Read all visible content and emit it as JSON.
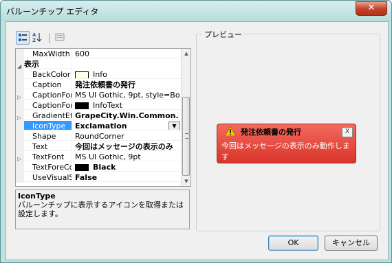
{
  "window": {
    "title": "バルーンチップ エディタ",
    "close_glyph": "✕"
  },
  "toolbar": {
    "categorized_icon": "categorized-view-icon",
    "alphabetical_icon": "sort-az-icon",
    "property_pages_icon": "property-pages-icon"
  },
  "grid": {
    "rows": [
      {
        "name": "MaxWidth",
        "value": "600",
        "type": "prop"
      },
      {
        "name": "表示",
        "value": "",
        "type": "category",
        "expander": "◢"
      },
      {
        "name": "BackColor",
        "value": "Info",
        "type": "color",
        "swatch": "#ffffe1"
      },
      {
        "name": "Caption",
        "value": "発注依頼書の発行",
        "type": "bold"
      },
      {
        "name": "CaptionFont",
        "value": "MS UI Gothic, 9pt, style=Bo",
        "type": "prop",
        "expander": "▷"
      },
      {
        "name": "CaptionForeC",
        "value": "InfoText",
        "type": "color",
        "swatch": "#000000"
      },
      {
        "name": "GradientEffec",
        "value": "GrapeCity.Win.Common.",
        "type": "bold",
        "expander": "▷"
      },
      {
        "name": "IconType",
        "value": "Exclamation",
        "type": "dropdown",
        "selected": true
      },
      {
        "name": "Shape",
        "value": "RoundCorner",
        "type": "prop"
      },
      {
        "name": "Text",
        "value": "今回はメッセージの表示のみ",
        "type": "bold"
      },
      {
        "name": "TextFont",
        "value": "MS UI Gothic, 9pt",
        "type": "prop",
        "expander": "▷"
      },
      {
        "name": "TextForeColo",
        "value": "Black",
        "type": "color-bold",
        "swatch": "#000000"
      },
      {
        "name": "UseVisualSty",
        "value": "False",
        "type": "bold"
      }
    ]
  },
  "description": {
    "title": "IconType",
    "text": "バルーンチップに表示するアイコンを取得または設定します。"
  },
  "preview": {
    "label": "プレビュー",
    "balloon": {
      "title": "発注依頼書の発行",
      "text": "今回はメッセージの表示のみ動作します",
      "close_glyph": "X",
      "icon": "warning-icon",
      "color": "#e04a3f"
    }
  },
  "buttons": {
    "ok": "OK",
    "cancel": "キャンセル"
  }
}
